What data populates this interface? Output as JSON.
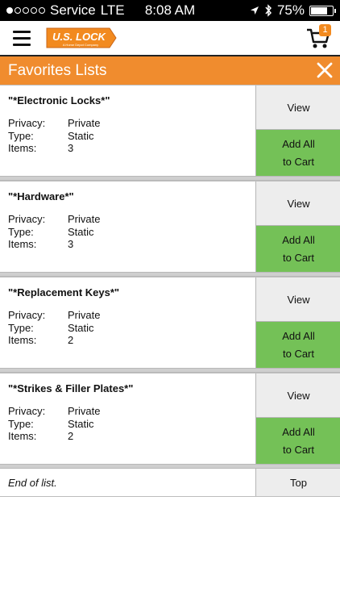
{
  "status_bar": {
    "carrier": "Service",
    "network": "LTE",
    "time": "8:08 AM",
    "battery": "75%",
    "battery_level": 0.75,
    "signal_strength": 1,
    "icons": [
      "location-arrow-icon",
      "bluetooth-icon",
      "battery-icon"
    ]
  },
  "header": {
    "logo_text": "U.S. LOCK",
    "logo_tagline": "A Home Depot Company",
    "cart_count": "1",
    "brand_color": "#f28a1f"
  },
  "titlebar": {
    "title": "Favorites Lists",
    "color": "#f08c2e"
  },
  "labels": {
    "privacy": "Privacy:",
    "type": "Type:",
    "items": "Items:",
    "view": "View",
    "add_all_line1": "Add All",
    "add_all_line2": "to Cart"
  },
  "lists": [
    {
      "name": "\"*Electronic Locks*\"",
      "privacy": "Private",
      "type": "Static",
      "items": "3"
    },
    {
      "name": "\"*Hardware*\"",
      "privacy": "Private",
      "type": "Static",
      "items": "3"
    },
    {
      "name": "\"*Replacement Keys*\"",
      "privacy": "Private",
      "type": "Static",
      "items": "2"
    },
    {
      "name": "\"*Strikes & Filler Plates*\"",
      "privacy": "Private",
      "type": "Static",
      "items": "2"
    }
  ],
  "footer": {
    "end_text": "End of list.",
    "top_label": "Top"
  },
  "colors": {
    "add_button": "#74c157",
    "view_button": "#ededed"
  }
}
